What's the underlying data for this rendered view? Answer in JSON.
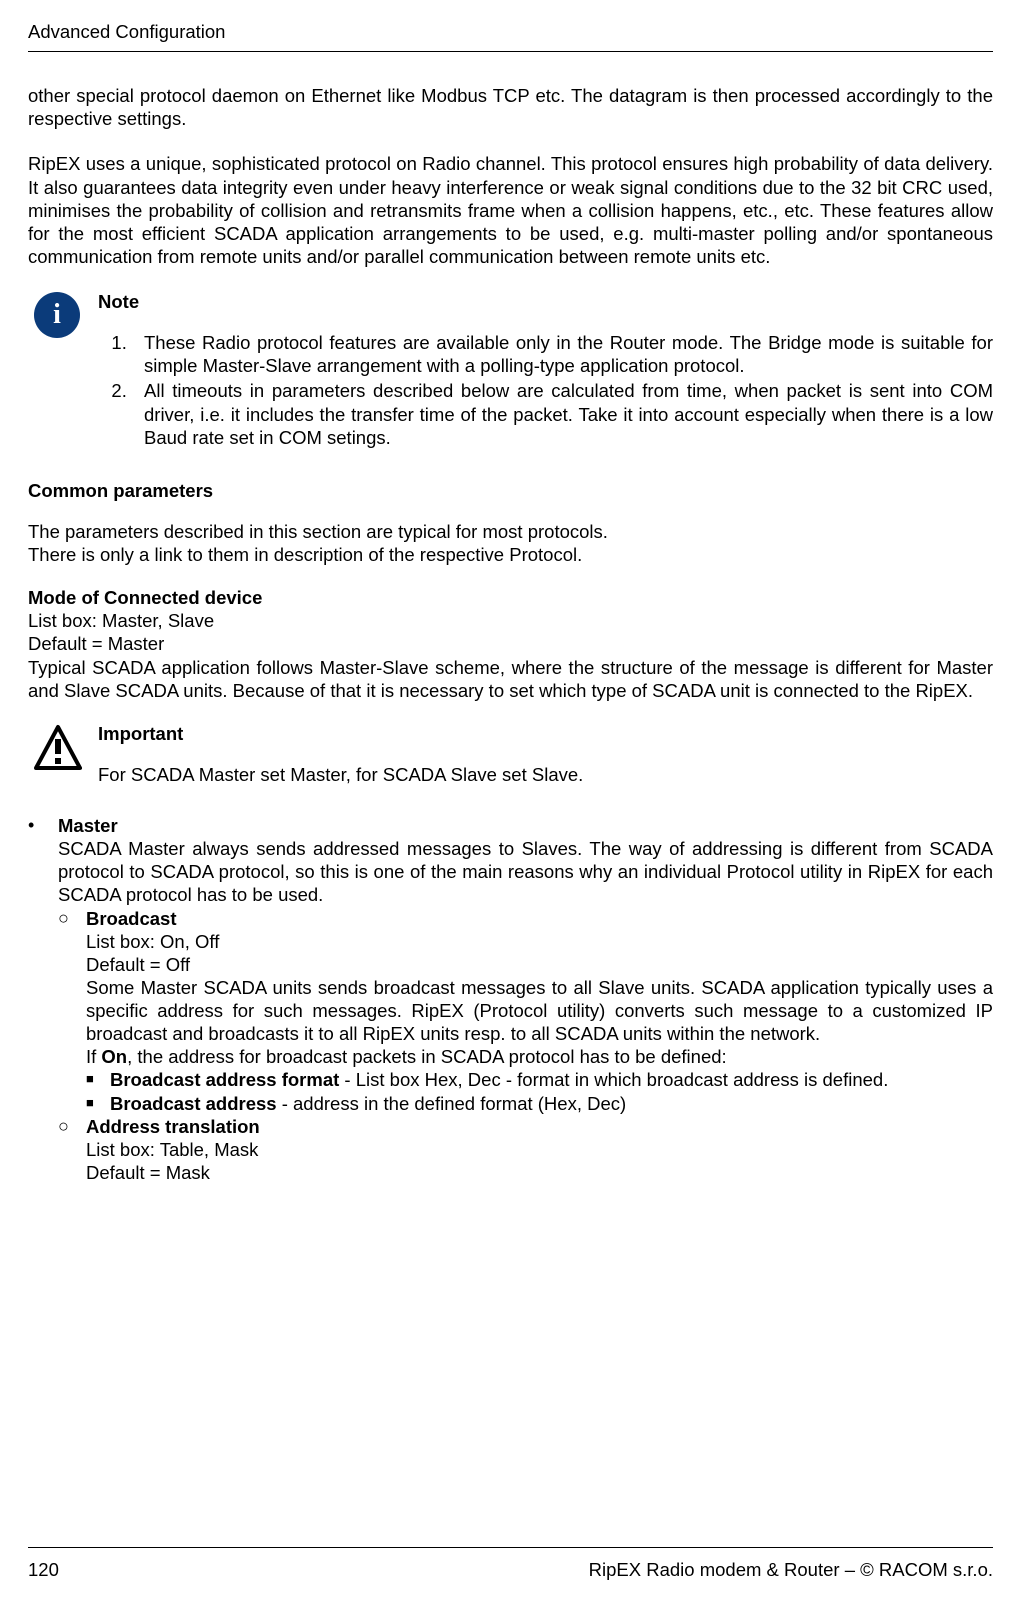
{
  "header": {
    "title": "Advanced Configuration"
  },
  "intro": {
    "p1": "other special protocol daemon on Ethernet like Modbus TCP etc. The datagram is then processed accordingly to the respective settings.",
    "p2": "RipEX uses a unique, sophisticated protocol on Radio channel. This protocol ensures high probability of data delivery. It also guarantees data integrity even under heavy interference or weak signal conditions due to the 32 bit CRC used, minimises the probability of collision and retransmits frame when a collision happens, etc., etc. These features allow for the most efficient SCADA application arrangements to be used, e.g. multi-master polling and/or spontaneous communication from remote units and/or parallel communication between remote units etc."
  },
  "note": {
    "title": "Note",
    "items": [
      "These Radio protocol features are available only in the Router mode. The Bridge mode is suitable for simple Master-Slave arrangement with a polling-type application protocol.",
      "All timeouts in parameters described below are calculated from time, when packet is sent into COM driver, i.e. it includes the transfer time of the packet. Take it into account especially when there is a low Baud rate set in COM setings."
    ]
  },
  "common": {
    "heading": "Common parameters",
    "p1": "The parameters described in this section are typical for most protocols.",
    "p2": "There is only a link to them in description of the respective Protocol."
  },
  "mode": {
    "heading": "Mode of Connected device",
    "l1": "List box: Master, Slave",
    "l2": "Default = Master",
    "p": "Typical SCADA application follows Master-Slave scheme, where the structure of the message is different for Master and Slave SCADA units. Because of that it is necessary to set which type of SCADA unit is connected to the RipEX."
  },
  "important": {
    "title": "Important",
    "text": "For SCADA Master set Master, for SCADA Slave set Slave."
  },
  "master": {
    "title": "Master",
    "text": "SCADA Master always sends addressed messages to Slaves. The way of addressing is different from SCADA protocol to SCADA protocol, so this is one of the main reasons why an individual Protocol utility in RipEX for each SCADA protocol has to be used.",
    "broadcast": {
      "title": "Broadcast",
      "l1": "List box: On, Off",
      "l2": "Default = Off",
      "p1": "Some Master SCADA units sends broadcast messages to all Slave units. SCADA application typically uses a specific address for such messages. RipEX (Protocol utility) converts such message to a customized IP broadcast and broadcasts it to all RipEX units resp. to all SCADA units within the network.",
      "p2a": "If ",
      "p2b": "On",
      "p2c": ", the address for broadcast packets in SCADA protocol has to be defined:",
      "fmt_title": "Broadcast address format",
      "fmt_text": " - List box Hex, Dec - format in which broadcast address is defined.",
      "addr_title": "Broadcast address",
      "addr_text": " - address in the defined format (Hex, Dec)"
    },
    "atrans": {
      "title": "Address translation",
      "l1": "List box: Table, Mask",
      "l2": "Default = Mask"
    }
  },
  "footer": {
    "page": "120",
    "right": "RipEX Radio modem & Router – © RACOM s.r.o."
  }
}
